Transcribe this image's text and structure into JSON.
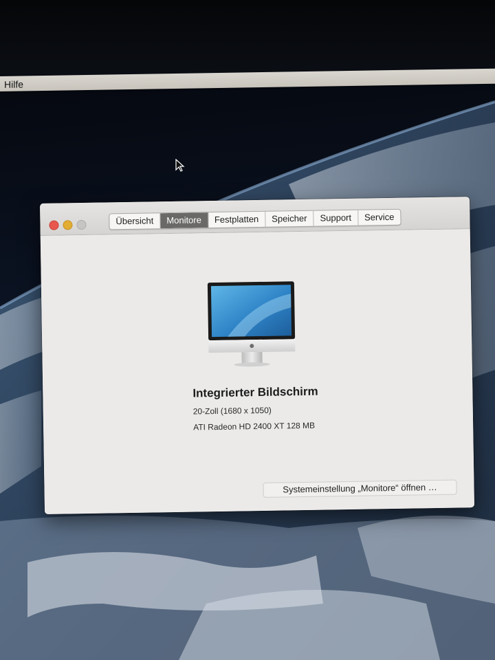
{
  "menubar": {
    "help_label": "Hilfe"
  },
  "window": {
    "tabs": [
      {
        "label": "Übersicht",
        "active": false
      },
      {
        "label": "Monitore",
        "active": true
      },
      {
        "label": "Festplatten",
        "active": false
      },
      {
        "label": "Speicher",
        "active": false
      },
      {
        "label": "Support",
        "active": false
      },
      {
        "label": "Service",
        "active": false
      }
    ],
    "display": {
      "name": "Integrierter Bildschirm",
      "size_resolution": "20-Zoll (1680 x 1050)",
      "graphics": "ATI Radeon HD 2400 XT 128 MB"
    },
    "prefs_button_label": "Systemeinstellung „Monitore“ öffnen …"
  },
  "colors": {
    "close": "#e8574e",
    "minimize": "#e2ad33",
    "zoom": "#c7c5c3",
    "active_tab": "#6a6968"
  }
}
